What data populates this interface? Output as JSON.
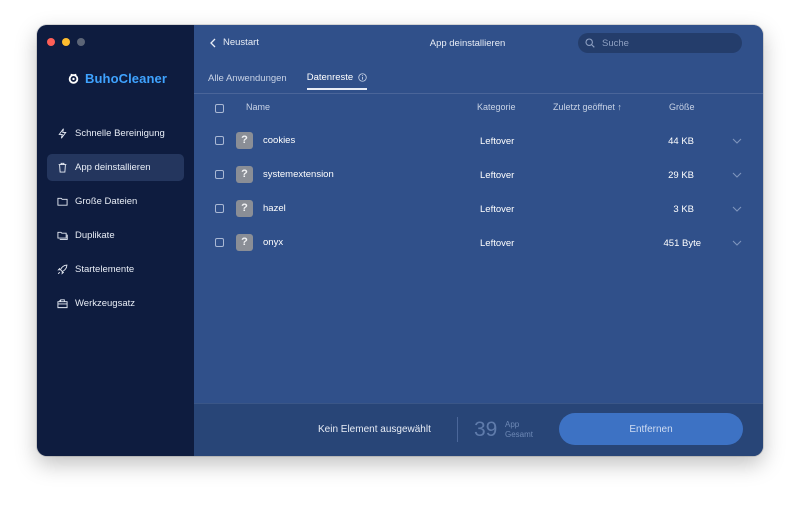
{
  "sidebar": {
    "brand": "BuhoCleaner",
    "items": [
      {
        "label": "Schnelle Bereinigung",
        "icon": "lightning-icon"
      },
      {
        "label": "App deinstallieren",
        "icon": "trash-icon"
      },
      {
        "label": "Große Dateien",
        "icon": "folder-icon"
      },
      {
        "label": "Duplikate",
        "icon": "duplicate-folder-icon"
      },
      {
        "label": "Startelemente",
        "icon": "rocket-icon"
      },
      {
        "label": "Werkzeugsatz",
        "icon": "toolbox-icon"
      }
    ],
    "active_index": 1
  },
  "header": {
    "back_label": "Neustart",
    "title": "App deinstallieren",
    "search_placeholder": "Suche"
  },
  "tabs": [
    {
      "label": "Alle Anwendungen"
    },
    {
      "label": "Datenreste"
    }
  ],
  "table": {
    "columns": {
      "name": "Name",
      "category": "Kategorie",
      "last_opened": "Zuletzt geöffnet ↑",
      "size": "Größe"
    },
    "rows": [
      {
        "name": "cookies",
        "category": "Leftover",
        "size": "44 KB"
      },
      {
        "name": "systemextension",
        "category": "Leftover",
        "size": "29 KB"
      },
      {
        "name": "hazel",
        "category": "Leftover",
        "size": "3 KB"
      },
      {
        "name": "onyx",
        "category": "Leftover",
        "size": "451 Byte"
      }
    ]
  },
  "footer": {
    "selection_text": "Kein Element ausgewählt",
    "count": "39",
    "count_label_line1": "App",
    "count_label_line2": "Gesamt",
    "remove_label": "Entfernen"
  },
  "colors": {
    "sidebar_bg": "#0e1c3f",
    "main_bg": "#30508a",
    "brand_accent": "#3fa3ff",
    "button_bg": "#3d72c4"
  }
}
